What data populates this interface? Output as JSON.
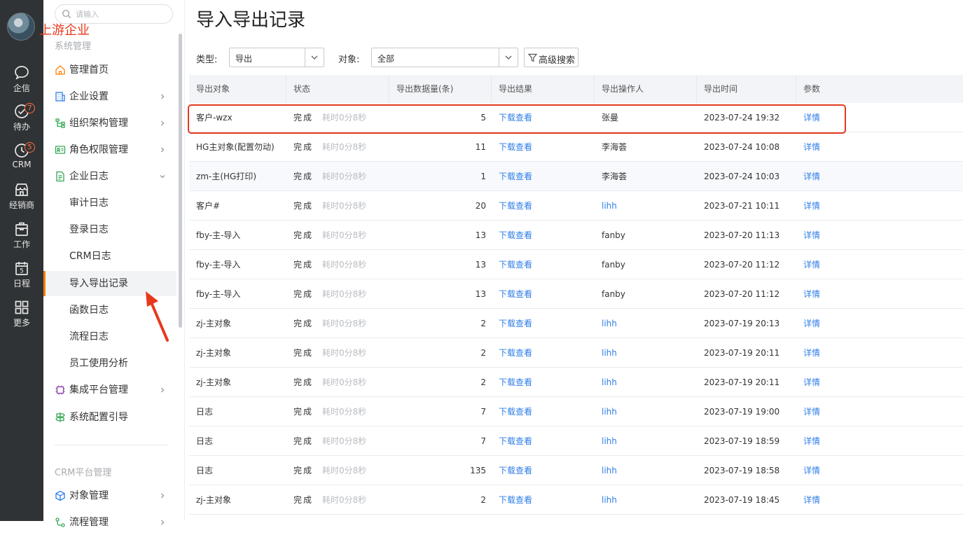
{
  "app": {
    "company_name": "上游企业"
  },
  "rail": {
    "items": [
      {
        "label": "企信",
        "icon": "chat-icon",
        "badge": ""
      },
      {
        "label": "待办",
        "icon": "check-circle-icon",
        "badge": "7"
      },
      {
        "label": "CRM",
        "icon": "clock-icon",
        "badge": "5"
      },
      {
        "label": "经销商",
        "icon": "store-icon",
        "badge": ""
      },
      {
        "label": "工作",
        "icon": "briefcase-icon",
        "badge": ""
      },
      {
        "label": "日程",
        "icon": "calendar-icon",
        "badge": ""
      },
      {
        "label": "更多",
        "icon": "grid-icon",
        "badge": ""
      }
    ],
    "calendar_day": "5"
  },
  "menu": {
    "search_placeholder": "请输入",
    "group_system": "系统管理",
    "group_crm": "CRM平台管理",
    "items": [
      {
        "label": "管理首页",
        "icon": "home-icon",
        "has_chevron": false
      },
      {
        "label": "企业设置",
        "icon": "building-icon",
        "has_chevron": true
      },
      {
        "label": "组织架构管理",
        "icon": "org-chart-icon",
        "has_chevron": true
      },
      {
        "label": "角色权限管理",
        "icon": "id-card-icon",
        "has_chevron": true
      },
      {
        "label": "企业日志",
        "icon": "log-icon",
        "has_chevron": true,
        "expanded": true
      }
    ],
    "sub_items": [
      "审计日志",
      "登录日志",
      "CRM日志",
      "导入导出记录",
      "函数日志",
      "流程日志",
      "员工使用分析"
    ],
    "active_sub": "导入导出记录",
    "items_after": [
      {
        "label": "集成平台管理",
        "icon": "chip-icon",
        "has_chevron": true
      },
      {
        "label": "系统配置引导",
        "icon": "signpost-icon",
        "has_chevron": false
      }
    ],
    "crm_items": [
      {
        "label": "对象管理",
        "icon": "cube-icon",
        "has_chevron": true
      },
      {
        "label": "流程管理",
        "icon": "flow-icon",
        "has_chevron": true
      }
    ]
  },
  "page": {
    "title": "导入导出记录",
    "filter_type_label": "类型:",
    "filter_type_value": "导出",
    "filter_object_label": "对象:",
    "filter_object_value": "全部",
    "advanced_search_label": "高级搜索"
  },
  "table": {
    "columns": [
      "导出对象",
      "状态",
      "导出数据量(条)",
      "导出结果",
      "导出操作人",
      "导出时间",
      "参数"
    ],
    "rows": [
      {
        "object": "客户-wzx",
        "status": "完成",
        "elapsed": "耗时0分8秒",
        "count": "5",
        "result": "下载查看",
        "operator": "张曼",
        "operator_link": false,
        "time": "2023-07-24 19:32",
        "param": "详情"
      },
      {
        "object": "HG主对象(配置勿动)",
        "status": "完成",
        "elapsed": "耗时0分8秒",
        "count": "11",
        "result": "下载查看",
        "operator": "李海荟",
        "operator_link": false,
        "time": "2023-07-24 10:08",
        "param": "详情"
      },
      {
        "object": "zm-主(HG打印)",
        "status": "完成",
        "elapsed": "耗时0分8秒",
        "count": "1",
        "result": "下载查看",
        "operator": "李海荟",
        "operator_link": false,
        "time": "2023-07-24 10:03",
        "param": "详情"
      },
      {
        "object": "客户#",
        "status": "完成",
        "elapsed": "耗时0分8秒",
        "count": "20",
        "result": "下载查看",
        "operator": "lihh",
        "operator_link": true,
        "time": "2023-07-21 10:11",
        "param": "详情"
      },
      {
        "object": "fby-主-导入",
        "status": "完成",
        "elapsed": "耗时0分8秒",
        "count": "13",
        "result": "下载查看",
        "operator": "fanby",
        "operator_link": false,
        "time": "2023-07-20 11:13",
        "param": "详情"
      },
      {
        "object": "fby-主-导入",
        "status": "完成",
        "elapsed": "耗时0分8秒",
        "count": "13",
        "result": "下载查看",
        "operator": "fanby",
        "operator_link": false,
        "time": "2023-07-20 11:12",
        "param": "详情"
      },
      {
        "object": "fby-主-导入",
        "status": "完成",
        "elapsed": "耗时0分8秒",
        "count": "13",
        "result": "下载查看",
        "operator": "fanby",
        "operator_link": false,
        "time": "2023-07-20 11:12",
        "param": "详情"
      },
      {
        "object": "zj-主对象",
        "status": "完成",
        "elapsed": "耗时0分8秒",
        "count": "2",
        "result": "下载查看",
        "operator": "lihh",
        "operator_link": true,
        "time": "2023-07-19 20:13",
        "param": "详情"
      },
      {
        "object": "zj-主对象",
        "status": "完成",
        "elapsed": "耗时0分8秒",
        "count": "2",
        "result": "下载查看",
        "operator": "lihh",
        "operator_link": true,
        "time": "2023-07-19 20:11",
        "param": "详情"
      },
      {
        "object": "zj-主对象",
        "status": "完成",
        "elapsed": "耗时0分8秒",
        "count": "2",
        "result": "下载查看",
        "operator": "lihh",
        "operator_link": true,
        "time": "2023-07-19 20:11",
        "param": "详情"
      },
      {
        "object": "日志",
        "status": "完成",
        "elapsed": "耗时0分8秒",
        "count": "7",
        "result": "下载查看",
        "operator": "lihh",
        "operator_link": true,
        "time": "2023-07-19 19:00",
        "param": "详情"
      },
      {
        "object": "日志",
        "status": "完成",
        "elapsed": "耗时0分8秒",
        "count": "7",
        "result": "下载查看",
        "operator": "lihh",
        "operator_link": true,
        "time": "2023-07-19 18:59",
        "param": "详情"
      },
      {
        "object": "日志",
        "status": "完成",
        "elapsed": "耗时0分8秒",
        "count": "135",
        "result": "下载查看",
        "operator": "lihh",
        "operator_link": true,
        "time": "2023-07-19 18:58",
        "param": "详情"
      },
      {
        "object": "zj-主对象",
        "status": "完成",
        "elapsed": "耗时0分8秒",
        "count": "2",
        "result": "下载查看",
        "operator": "lihh",
        "operator_link": true,
        "time": "2023-07-19 18:45",
        "param": "详情"
      }
    ]
  },
  "colors": {
    "accent": "#ff8000",
    "link": "#2f7ee8",
    "highlight": "#e33b1e",
    "rail_bg": "#2f3335"
  }
}
